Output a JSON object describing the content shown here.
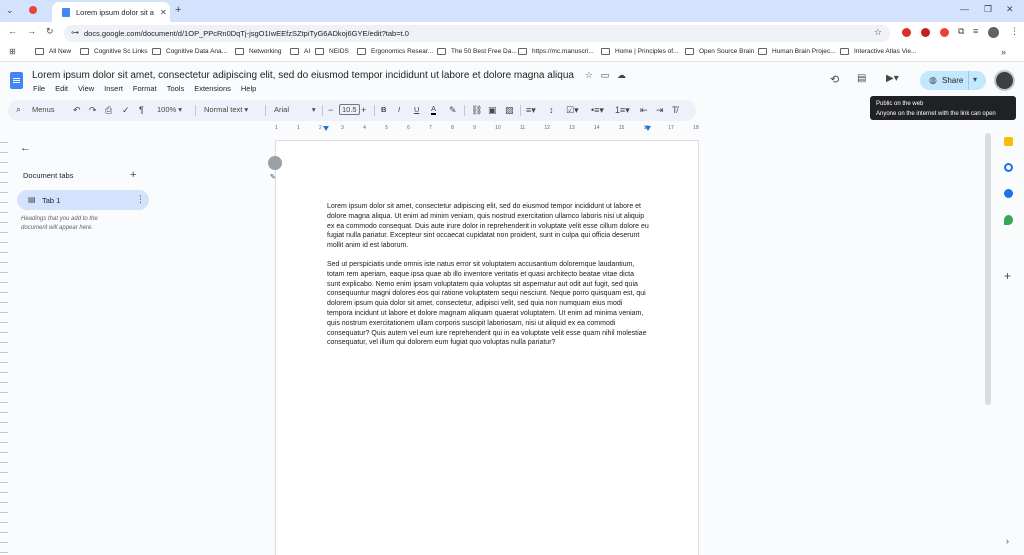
{
  "browser": {
    "tab_title": "Lorem ipsum dolor sit amet, co",
    "url": "docs.google.com/document/d/1OP_PPcRn0DqTj-jsgO1IwEEfzSZtpiTyG6ADkoj6GYE/edit?tab=t.0",
    "bookmarks": [
      "All New",
      "Cognitive Sc Links",
      "Cognitive Data Ana...",
      "Networking",
      "AI",
      "NEIDS",
      "Ergonomics Resear...",
      "The 50 Best Free Da...",
      "https://mc.manuscri...",
      "Home | Principles of...",
      "Open Source Brain",
      "Human Brain Projec...",
      "Interactive Atlas Vie..."
    ]
  },
  "doc": {
    "title": "Lorem ipsum dolor sit amet, consectetur adipiscing elit, sed do eiusmod tempor incididunt ut labore et dolore magna aliqua",
    "menus": [
      "File",
      "Edit",
      "View",
      "Insert",
      "Format",
      "Tools",
      "Extensions",
      "Help"
    ],
    "share_label": "Share",
    "tooltip_line1": "Public on the web",
    "tooltip_line2": "Anyone on the internet with the link can open"
  },
  "toolbar": {
    "menus_label": "Menus",
    "zoom": "100%",
    "style": "Normal text",
    "font": "Arial",
    "font_size": "10.5"
  },
  "ruler": {
    "labels": [
      "1",
      "1",
      "2",
      "3",
      "4",
      "5",
      "6",
      "7",
      "8",
      "9",
      "10",
      "11",
      "12",
      "13",
      "14",
      "15",
      "16",
      "17",
      "18"
    ]
  },
  "sidebar": {
    "heading": "Document tabs",
    "tab_label": "Tab 1",
    "hint": "Headings that you add to the document will appear here."
  },
  "content": {
    "p1": "Lorem ipsum dolor sit amet, consectetur adipiscing elit, sed do eiusmod tempor incididunt ut labore et dolore magna aliqua. Ut enim ad minim veniam, quis nostrud exercitation ullamco laboris nisi ut aliquip ex ea commodo consequat. Duis aute irure dolor in reprehenderit in voluptate velit esse cillum dolore eu fugiat nulla pariatur. Excepteur sint occaecat cupidatat non proident, sunt in culpa qui officia deserunt mollit anim id est laborum.",
    "p2": "Sed ut perspiciatis unde omnis iste natus error sit voluptatem accusantium doloremque laudantium, totam rem aperiam, eaque ipsa quae ab illo inventore veritatis et quasi architecto beatae vitae dicta sunt explicabo. Nemo enim ipsam voluptatem quia voluptas sit aspernatur aut odit aut fugit, sed quia consequuntur magni dolores eos qui ratione voluptatem sequi nesciunt. Neque porro quisquam est, qui dolorem ipsum quia dolor sit amet, consectetur, adipisci velit, sed quia non numquam eius modi tempora incidunt ut labore et dolore magnam aliquam quaerat voluptatem. Ut enim ad minima veniam, quis nostrum exercitationem ullam corporis suscipit laboriosam, nisi ut aliquid ex ea commodi consequatur? Quis autem vel eum iure reprehenderit qui in ea voluptate velit esse quam nihil molestiae consequatur, vel illum qui dolorem eum fugiat quo voluptas nulla pariatur?"
  }
}
